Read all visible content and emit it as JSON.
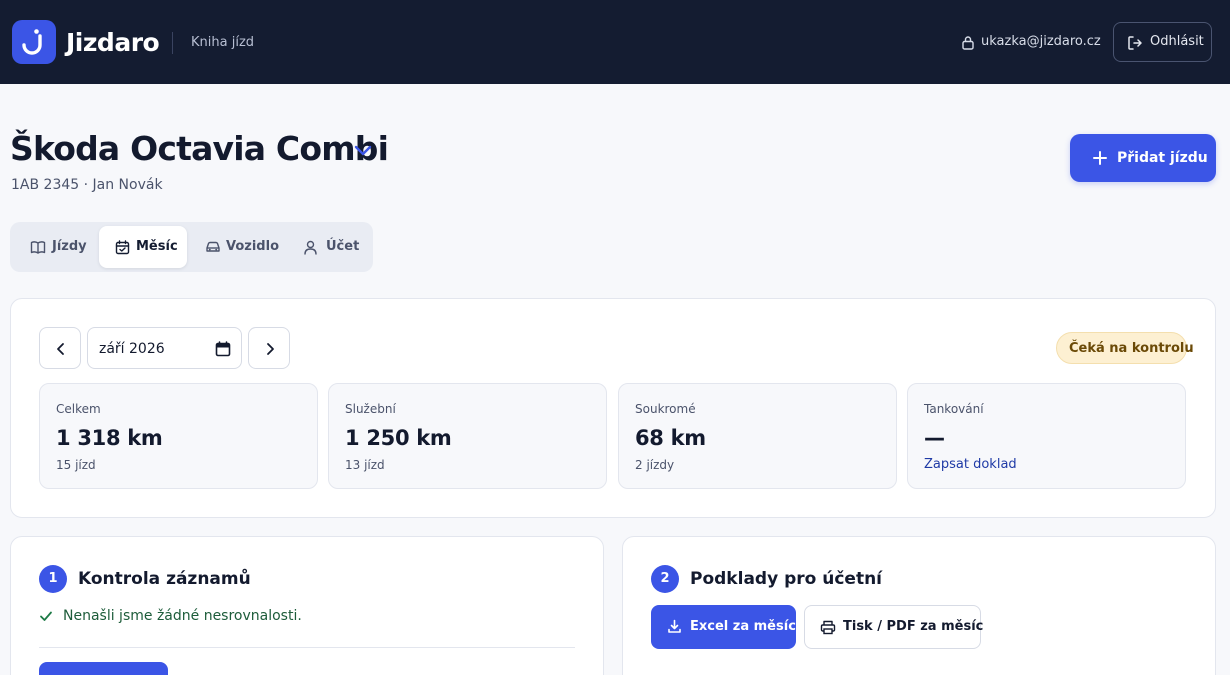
{
  "header": {
    "brand": "Jizdaro",
    "subtitle": "Kniha jízd",
    "user_email": "ukazka@jizdaro.cz",
    "logout_label": "Odhlásit",
    "bg_color": "#141c31",
    "accent": "#3b55e6"
  },
  "vehicle": {
    "title": "Škoda Octavia Combi",
    "subtitle": "1AB 2345 · Jan Novák"
  },
  "actions": {
    "add_trip_label": "Přidat jízdu"
  },
  "tabs": [
    {
      "label": "Jízdy",
      "icon": "book-icon",
      "active": false
    },
    {
      "label": "Měsíc",
      "icon": "calendar-check-icon",
      "active": true
    },
    {
      "label": "Vozidlo",
      "icon": "car-icon",
      "active": false
    },
    {
      "label": "Účet",
      "icon": "user-icon",
      "active": false
    }
  ],
  "month": {
    "value": "září  2026",
    "status": "Čeká na kontrolu",
    "status_color": "#fdf0d2"
  },
  "stats": [
    {
      "label": "Celkem",
      "value": "1 318 km",
      "sub": "15 jízd"
    },
    {
      "label": "Služební",
      "value": "1 250 km",
      "sub": "13 jízd"
    },
    {
      "label": "Soukromé",
      "value": "68 km",
      "sub": "2 jízdy"
    },
    {
      "label": "Tankování",
      "value": "—",
      "link": "Zapsat doklad"
    }
  ],
  "review": {
    "step": "1",
    "title": "Kontrola záznamů",
    "message": "Nenašli jsme žádné nesrovnalosti."
  },
  "accounting": {
    "step": "2",
    "title": "Podklady pro účetní",
    "excel_label": "Excel za měsíc",
    "print_label": "Tisk / PDF za měsíc"
  }
}
